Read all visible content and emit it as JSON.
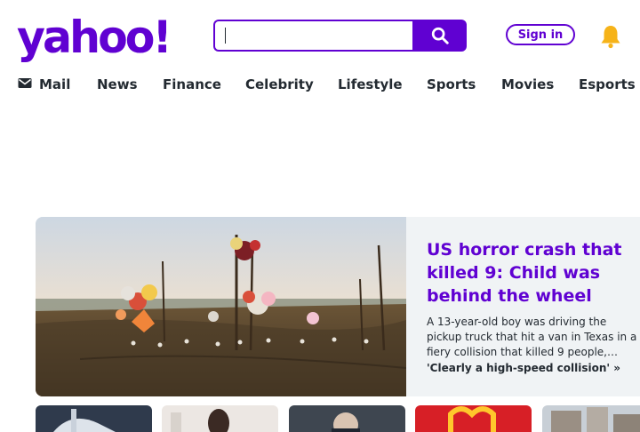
{
  "header": {
    "logo_text": "yahoo!",
    "search": {
      "value": "",
      "placeholder": ""
    },
    "sign_in_label": "Sign in"
  },
  "nav": {
    "items": [
      {
        "label": "Mail",
        "icon": "envelope-icon"
      },
      {
        "label": "News"
      },
      {
        "label": "Finance"
      },
      {
        "label": "Celebrity"
      },
      {
        "label": "Lifestyle"
      },
      {
        "label": "Sports"
      },
      {
        "label": "Movies"
      },
      {
        "label": "Esports"
      }
    ]
  },
  "hero": {
    "title": "US horror crash that killed 9: Child was behind the wheel",
    "description": "A 13-year-old boy was driving the pickup truck that hit a van in Texas in a fiery collision that killed 9 people,…",
    "link": "'Clearly a high-speed collision' »"
  },
  "colors": {
    "brand": "#6001d2",
    "text": "#232a31",
    "bell": "#f6b319",
    "hero_panel": "#f0f3f5"
  }
}
